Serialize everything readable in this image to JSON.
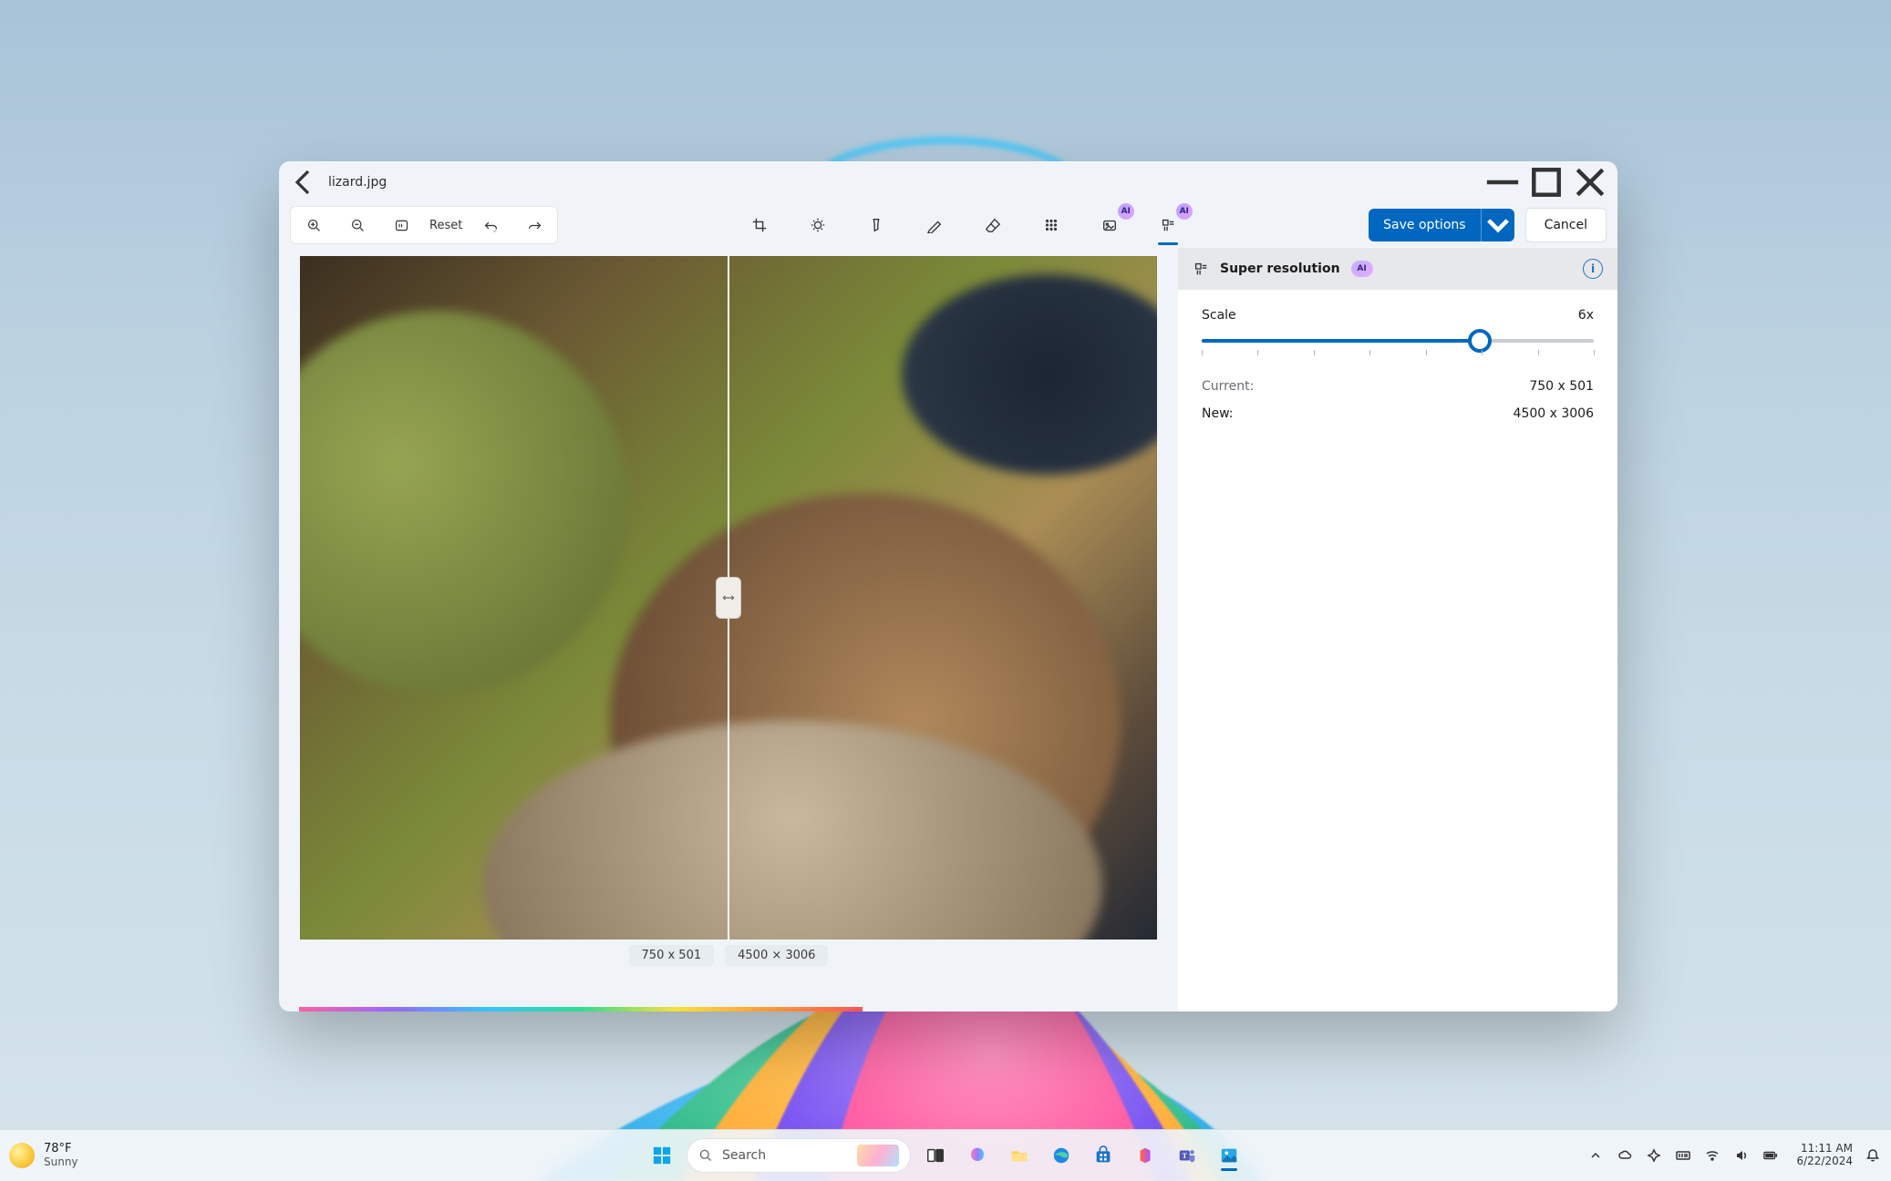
{
  "window": {
    "filename": "lizard.jpg",
    "toolbar": {
      "reset_label": "Reset",
      "save_label": "Save options",
      "cancel_label": "Cancel",
      "ai_badge": "AI"
    },
    "canvas": {
      "size_left": "750 x 501",
      "size_right": "4500 × 3006"
    },
    "panel": {
      "title": "Super resolution",
      "ai_badge": "AI",
      "scale_label": "Scale",
      "scale_value": "6x",
      "slider_percent": 71,
      "current_label": "Current:",
      "current_value": "750 x 501",
      "new_label": "New:",
      "new_value": "4500 x 3006"
    }
  },
  "taskbar": {
    "weather_temp": "78°F",
    "weather_cond": "Sunny",
    "search_placeholder": "Search",
    "clock_time": "11:11 AM",
    "clock_date": "6/22/2024"
  }
}
